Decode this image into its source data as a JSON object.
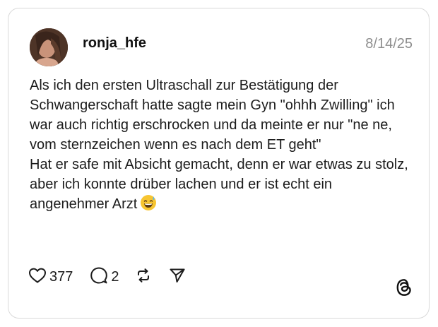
{
  "post": {
    "username": "ronja_hfe",
    "date": "8/14/25",
    "paragraphs": [
      "Als ich den ersten Ultraschall zur Bestätigung der Schwangerschaft hatte sagte mein Gyn \"ohhh Zwilling\" ich war auch richtig erschrocken und da meinte er nur \"ne ne, vom sternzeichen wenn es nach dem ET geht\"",
      "Hat er safe mit Absicht gemacht, denn er war etwas zu stolz, aber ich konnte drüber lachen und er ist echt ein angenehmer Arzt"
    ],
    "emoji": "grinning-face-with-sweat-emoji"
  },
  "actions": {
    "like_count": "377",
    "reply_count": "2"
  },
  "icons": {
    "like": "heart-icon",
    "reply": "speech-bubble-icon",
    "repost": "repost-arrows-icon",
    "share": "send-paper-plane-icon",
    "brand": "threads-logo-icon"
  },
  "colors": {
    "text": "#1c1c1c",
    "muted": "#8e8e8e",
    "border": "#d9d9d9",
    "emoji": "#f7c531"
  }
}
